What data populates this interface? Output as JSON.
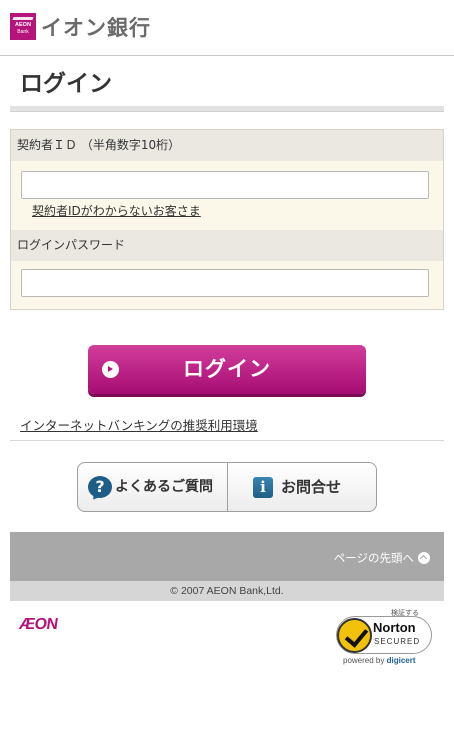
{
  "header": {
    "logo_lines": [
      "AEON",
      "Bank"
    ],
    "bank_name": "イオン銀行"
  },
  "page_title": "ログイン",
  "form": {
    "id_label": "契約者ＩＤ （半角数字10桁）",
    "id_value": "",
    "forgot_id_link": "契約者IDがわからないお客さま",
    "password_label": "ログインパスワード",
    "password_value": ""
  },
  "login_button": {
    "label": "ログイン",
    "icon": "arrow-right-circle-icon"
  },
  "environment_link": "インターネットバンキングの推奨利用環境",
  "help_buttons": [
    {
      "label": "よくあるご質問",
      "icon": "question-bubble-icon",
      "icon_glyph": "?"
    },
    {
      "label": "お問合せ",
      "icon": "info-icon",
      "icon_glyph": "i"
    }
  ],
  "footer": {
    "back_to_top": "ページの先頭へ",
    "copyright": "© 2007 AEON Bank,Ltd.",
    "aeon_logo": "ÆON"
  },
  "norton_badge": {
    "verify_text": "検証する",
    "brand": "Norton",
    "secured": "SECURED",
    "powered_prefix": "powered by",
    "powered_brand": "digicert"
  },
  "colors": {
    "brand_magenta": "#b5157b",
    "label_bg": "#ebe8e2",
    "form_bg": "#fbf8e9",
    "footer_gray": "#a8a8a8",
    "help_icon_blue": "#1e5d86"
  }
}
